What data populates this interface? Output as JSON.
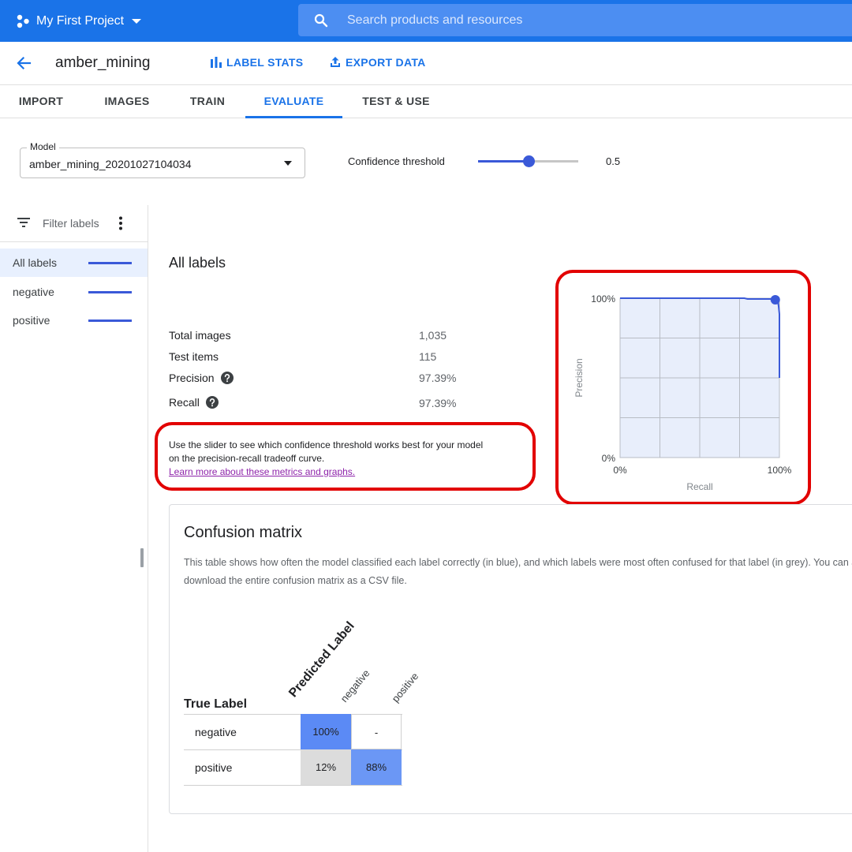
{
  "topbar": {
    "project_name": "My First Project",
    "search_placeholder": "Search products and resources",
    "color": "#1a73e8"
  },
  "header": {
    "dataset_name": "amber_mining",
    "label_stats": "LABEL STATS",
    "export_data": "EXPORT DATA"
  },
  "tabs": [
    {
      "label": "IMPORT",
      "active": false
    },
    {
      "label": "IMAGES",
      "active": false
    },
    {
      "label": "TRAIN",
      "active": false
    },
    {
      "label": "EVALUATE",
      "active": true
    },
    {
      "label": "TEST & USE",
      "active": false
    }
  ],
  "model": {
    "legend": "Model",
    "value": "amber_mining_20201027104034"
  },
  "confidence": {
    "label": "Confidence threshold",
    "value": 0.5,
    "value_text": "0.5"
  },
  "sidebar": {
    "filter_label": "Filter labels",
    "items": [
      {
        "label": "All labels",
        "active": true
      },
      {
        "label": "negative",
        "active": false
      },
      {
        "label": "positive",
        "active": false
      }
    ],
    "series_color": "#3a59d8"
  },
  "summary": {
    "title": "All labels",
    "stats": [
      {
        "label": "Total images",
        "value": "1,035",
        "help": false
      },
      {
        "label": "Test items",
        "value": "115",
        "help": false
      },
      {
        "label": "Precision",
        "value": "97.39%",
        "help": true
      },
      {
        "label": "Recall",
        "value": "97.39%",
        "help": true
      }
    ],
    "hint_line1": "Use the slider to see which confidence threshold works best for your model",
    "hint_line2": "on the precision-recall tradeoff curve.",
    "hint_link": "Learn more about these metrics and graphs."
  },
  "pr_chart": {
    "y_top": "100%",
    "y_bottom": "0%",
    "x_left": "0%",
    "x_right": "100%",
    "xlabel": "Recall",
    "ylabel": "Precision",
    "curve": [
      [
        0,
        1.0
      ],
      [
        0.78,
        1.0
      ],
      [
        0.8,
        0.995
      ],
      [
        0.975,
        0.995
      ],
      [
        0.99,
        0.98
      ],
      [
        0.995,
        0.95
      ],
      [
        1.0,
        0.9
      ],
      [
        1.0,
        0.5
      ]
    ],
    "threshold_point": [
      0.974,
      0.99
    ]
  },
  "confusion_matrix": {
    "title": "Confusion matrix",
    "description": "This table shows how often the model classified each label correctly (in blue), and which labels were most often confused for that label (in grey). You can also download the entire confusion matrix as a CSV file.",
    "predicted_header": "Predicted Label",
    "true_header": "True Label",
    "columns": [
      "negative",
      "positive"
    ],
    "rows": [
      {
        "label": "negative",
        "cells": [
          "100%",
          "-"
        ]
      },
      {
        "label": "positive",
        "cells": [
          "12%",
          "88%"
        ]
      }
    ],
    "colors": {
      "strong": "#5b8af5",
      "medium": "#6b97f5",
      "grey": "#dcdcdc",
      "empty": "#ffffff"
    }
  },
  "highlight_color": "#e20000"
}
